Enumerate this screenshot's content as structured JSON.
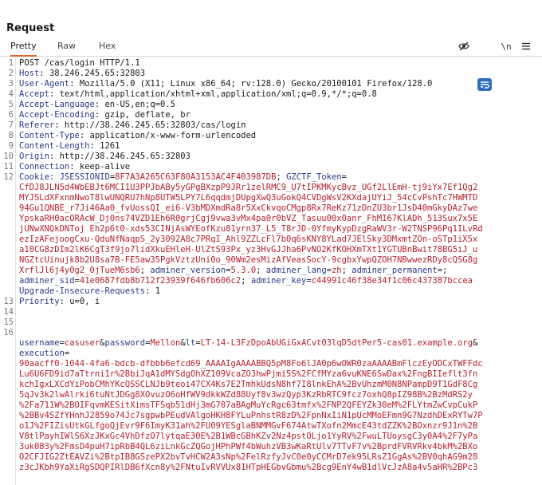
{
  "panel": {
    "title": "Request"
  },
  "tabs": [
    {
      "label": "Pretty",
      "active": true
    },
    {
      "label": "Raw",
      "active": false
    },
    {
      "label": "Hex",
      "active": false
    }
  ],
  "toolbar": {
    "icons": [
      "hide-eye-icon",
      "word-wrap-icon",
      "newline-icon",
      "menu-icon"
    ],
    "newline_label": "\\n"
  },
  "colors": {
    "accent": "#e0652a",
    "header_key": "#2b3a8a",
    "value": "#b5222d",
    "wrap_button": "#2f6fbf"
  },
  "request": {
    "line1": "POST /cas/login HTTP/1.1",
    "headers": [
      {
        "key": "Host",
        "value": " 38.246.245.65:32803"
      },
      {
        "key": "User-Agent",
        "value": " Mozilla/5.0 (X11; Linux x86_64; rv:128.0) Gecko/20100101 Firefox/128.0"
      },
      {
        "key": "Accept",
        "value": " text/html,application/xhtml+xml,application/xml;q=0.9,*/*;q=0.8"
      },
      {
        "key": "Accept-Language",
        "value": " en-US,en;q=0.5"
      },
      {
        "key": "Accept-Encoding",
        "value": " gzip, deflate, br"
      },
      {
        "key": "Referer",
        "value": " http://38.246.245.65:32803/cas/login"
      },
      {
        "key": "Content-Type",
        "value": " application/x-www-form-urlencoded"
      },
      {
        "key": "Content-Length",
        "value": " 1261"
      },
      {
        "key": "Origin",
        "value": " http://38.246.245.65:32803"
      },
      {
        "key": "Connection",
        "value": " keep-alive"
      }
    ],
    "cookie": {
      "key": "Cookie:",
      "jsession_key": "JSESSIONID",
      "jsession_val": "8F7A3A265C63F80A3153AC4F403987DB",
      "token_key": "GZCTF_Token",
      "token_lines": [
        "CfDJ8JLN5d4WbEBJt6MCI1U3PPJbABy5yGPgBXzpP9JRr1zelRMC9_U7tIPKMKycBvz_UGf2LlEmH-tj9iYx7Ef1Qg2",
        "MYJSLdXFxnmNwoT8lwUNQRU7hNp8UTW5LPY7L6qqdmjDUpgXwQ3uGokQ4CVDgWsV2KXdajUYiJ_54cCvPshTc7HWMTD",
        "94Gu1QNBE_r7Ji46Aa0_fvUossQI_ei6-V3bMDXmdRa8r5XxCkvqoCMgp8Rx7ReKz71zDnZU3br1JsD40mGkyDAz7we",
        "YpskaRH0acORAcW_Dj0ns74VZD1Eh6R0grjCgj9vwa3vMx4pa0r0bVZ_Tasuu00x0anr_FhMI67KlADh_513Sux7x5E",
        "jUNwXNQkDNToj Eh2p6t0-xds53CINjAsWYEofKzu81yrn37_L5_T8rJD-0YfmyKypDzgRaWV3r-W2TNSP96Pq1ILvRd",
        "ezIzAFejoogCxu-QduNfNaqpS_2y3092A8c7PRqI_Ahl9ZZLcFl7b0q6sKNY8YLad7JElSky3DMxmtZOn-oSTp1iX5x",
        "a10CG8zDIm2lK6CgT3f9jo7lidXkuEHleH-UlZtS93Px_yz3HvGJJha6PvNO2KfKOHXmTXt1YGTUBnBwit78BG5iJ_u",
        "NGZtcUinujk8b2U8sa7B-FE5aw35PgkVztzUni0o_90Wm2esMizAfVeasSocY-9cgbxYwpQZOH7NBwwezRDy8cQSG8g",
        "XrflJl6j4y0g2_0jTueM6sb6"
      ],
      "rest": [
        {
          "key": "adminer_version",
          "value": "5.3.0"
        },
        {
          "key": "adminer_lang",
          "value": "zh"
        },
        {
          "key": "adminer_permanent",
          "value": ""
        },
        {
          "key": "adminer_sid",
          "value": "41e0687fdb8b712f23939f646fb606c2"
        },
        {
          "key": "adminer_key",
          "value": "c44991c46f38e34f1c06c437387bccea"
        }
      ]
    },
    "after": [
      {
        "key": "Upgrade-Insecure-Requests",
        "value": " 1"
      },
      {
        "key": "Priority",
        "value": " u=0, i"
      }
    ],
    "body": {
      "username_key": "username",
      "username_val": "casuser",
      "password_key": "password",
      "password_val": "Mellon",
      "lt_key": "lt",
      "lt_val": "LT-14-L3FzDpoAbUGiGxACvt03lqD5dtPer5-cas01.example.org",
      "execution_key": "execution",
      "execution_lines": [
        "90aacff0-1044-4fa6-bdcb-dfbbb6efcd69_AAAAIgAAAABBQ5pM8Fo6lJA0p6wOWR0zaAAAABmFlczEyODCxTWFFdc",
        "Lu6U6FD9id7aTtrni1r%2BbiJqA1dMYSdgOhXZ109VcaZO3hwPjmi5S%2FCfMYza6vuKNE6SwDax%2FngBIIeflt3fn",
        "kchIgxLXCdYiPobCMhYKcQSSCLNJb9teoi47CX4Ks7E2TmhkUdsN8hf7I8lnkEhA%2BvUhzmM0N8NPampD9T1GdF8Cg",
        "5qJv3k2lwAlrki6tuNtJDGg8XOvuzO6oHfWV9dkkWZd88Uyf8v3wzQyp3KzRbRTC9fcz7oxhQ8pIZ98B%2BzMdRS2y",
        "%2Fa711W%2BOIFqvmKESitXimsTFSqb51dHj3mG707aBAgMuYcRgc63tmfx%2FNP2QFEYZk30eM%2FLYtmZwCvpCukP",
        "%2BBv4SZfYHnhJ2859o74Jc7sgpwbPEudVAlgoHKH8FYLuPnhstR8zD%2FpnNxIiN1pUcMMoEFmn9G7NzdhDExRYTw7P",
        "o1J%2FIZisUtkGLfgoQjEvr9F6ImyK31ah%2FU09YESglaBNMMGvF674AtwTXofn2MmcE43tdZZK%2BOxnzr9J1n%2B",
        "V8tlPayhIWlS6XzJKxGc4VhDfzO7lytqaE30E%2B1WBcGBhKZv2Nz4pstOLjo1YyRV%2FwuLTUoysgC3y0A4%2F7yPa",
        "3uk083y%2FmsD4puH7ipRbB4QL6ziLnkGcZQGojHPhPWf4bWuhzVB3wKaRtUlv7TTvF7v%2BprdFVRVRkv4bkM%2BXo",
        "O2CFJIG2ZtEAVZi%2BtpIB8GSzePX2bvTvHCW2A3sNp%2FelRzfyJvC0e0yCCMrD7ek95LRsZ1GgAs%2BV0qhAG9m28",
        "z3cJKbh9YaXiRgSDQPIRlDB6fXcn8y%2FNtuIvRVVUx81HTpHEGbvGbmu%2Bcg9EnY4wB1dlVcJzA8a4v5aHR%2BPc3"
      ]
    }
  }
}
